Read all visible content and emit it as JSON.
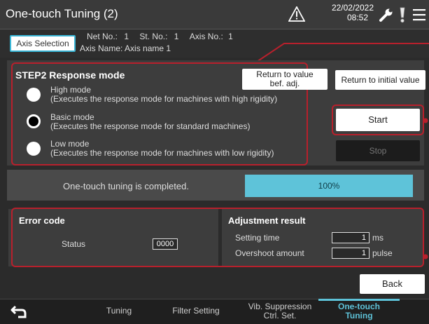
{
  "header": {
    "title": "One-touch Tuning (2)",
    "date": "22/02/2022",
    "time": "08:52",
    "icons": [
      "warning-icon",
      "wrench-icon",
      "alert-icon",
      "menu-icon"
    ]
  },
  "axis_info": {
    "axis_selection_label": "Axis Selection",
    "net_no_label": "Net No.:",
    "net_no": "1",
    "st_no_label": "St. No.:",
    "st_no": "1",
    "axis_no_label": "Axis No.:",
    "axis_no": "1",
    "axis_name_label": "Axis Name:",
    "axis_name": "Axis name 1"
  },
  "step2": {
    "title": "STEP2 Response mode",
    "modes": [
      {
        "name": "High mode",
        "desc": "(Executes the response mode for machines with high rigidity)",
        "selected": false
      },
      {
        "name": "Basic mode",
        "desc": "(Executes the response mode for standard machines)",
        "selected": true
      },
      {
        "name": "Low mode",
        "desc": "(Executes the response mode for machines with low rigidity)",
        "selected": false
      }
    ],
    "return_before_adj_line1": "Return to value",
    "return_before_adj_line2": "bef. adj.",
    "return_initial_label": "Return to initial value",
    "start_label": "Start",
    "stop_label": "Stop"
  },
  "status_bar": {
    "message": "One-touch tuning is completed.",
    "progress_label": "100%",
    "progress_fraction": 1.0
  },
  "error_code": {
    "title": "Error code",
    "status_label": "Status",
    "status_value": "0000"
  },
  "adjustment": {
    "title": "Adjustment result",
    "setting_time_label": "Setting time",
    "setting_time_value": "1",
    "setting_time_unit": "ms",
    "overshoot_label": "Overshoot amount",
    "overshoot_value": "1",
    "overshoot_unit": "pulse"
  },
  "back_label": "Back",
  "footer": {
    "tabs": [
      {
        "label1": "Tuning",
        "label2": ""
      },
      {
        "label1": "Filter Setting",
        "label2": ""
      },
      {
        "label1": "Vib. Suppression",
        "label2": "Ctrl. Set."
      },
      {
        "label1": "One-touch",
        "label2": "Tuning"
      }
    ],
    "active_tab": 3
  },
  "colors": {
    "accent": "#5ec3d9",
    "annotation": "#b8202c",
    "background": "#2b2b2b"
  }
}
